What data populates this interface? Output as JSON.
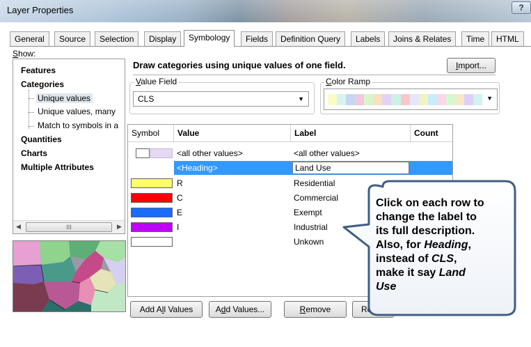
{
  "window": {
    "title": "Layer Properties",
    "help_glyph": "?"
  },
  "tabs": [
    {
      "label": "General"
    },
    {
      "label": "Source"
    },
    {
      "label": "Selection"
    },
    {
      "label": "Display"
    },
    {
      "label": "Symbology"
    },
    {
      "label": "Fields"
    },
    {
      "label": "Definition Query"
    },
    {
      "label": "Labels"
    },
    {
      "label": "Joins & Relates"
    },
    {
      "label": "Time"
    },
    {
      "label": "HTML"
    }
  ],
  "active_tab": "Symbology",
  "show": {
    "label": "Show:",
    "items": [
      {
        "label": "Features"
      },
      {
        "label": "Categories"
      },
      {
        "label": "Unique values"
      },
      {
        "label": "Unique values, many"
      },
      {
        "label": "Match to symbols in a"
      },
      {
        "label": "Quantities"
      },
      {
        "label": "Charts"
      },
      {
        "label": "Multiple Attributes"
      }
    ],
    "scroll_thumb_glyph": "III"
  },
  "description": "Draw categories using unique values of one field.",
  "import_button": "Import...",
  "value_field": {
    "legend": "Value Field",
    "value": "CLS"
  },
  "color_ramp": {
    "legend": "Color Ramp",
    "colors": [
      "#fbfbc8",
      "#d8f2f2",
      "#c6d6f6",
      "#f2c8dc",
      "#d8f5cc",
      "#f8e0c0",
      "#e4d2f4",
      "#ccf2e4",
      "#f8c8c8",
      "#e6e6fa",
      "#f2f2c2",
      "#c8ecfa",
      "#fcd6e6",
      "#d6f8d0",
      "#f6e8c8",
      "#ddd0f6",
      "#d0f4f0"
    ]
  },
  "table": {
    "headers": {
      "symbol": "Symbol",
      "value": "Value",
      "label": "Label",
      "count": "Count"
    },
    "rows": [
      {
        "value": "<all other values>",
        "label": "<all other values>",
        "count": "",
        "color": "#e6d8f4",
        "swatch_color": "#ffffff"
      },
      {
        "value": "<Heading>",
        "label": "Land Use",
        "count": "",
        "heading": true
      },
      {
        "value": "R",
        "label": "Residential",
        "count": "?",
        "color": "#ffff66"
      },
      {
        "value": "C",
        "label": "Commercial",
        "count": "",
        "color": "#ff0000"
      },
      {
        "value": "E",
        "label": "Exempt",
        "count": "",
        "color": "#1a6bff"
      },
      {
        "value": "I",
        "label": "Industrial",
        "count": "",
        "color": "#c000ff"
      },
      {
        "value": "",
        "label": "Unkown",
        "count": "",
        "color": "#ffffff"
      }
    ]
  },
  "callout": {
    "lines": [
      {
        "text": "Click on each row to"
      },
      {
        "text": "change the label to"
      },
      {
        "text": "its full description."
      },
      {
        "text": "Also, for "
      },
      {
        "text": "Heading"
      },
      {
        "text": ","
      },
      {
        "text": "instead of "
      },
      {
        "text": "CLS"
      },
      {
        "text": ","
      },
      {
        "text": "make it say "
      },
      {
        "text": "Land"
      },
      {
        "text": "Use"
      }
    ]
  },
  "buttons": {
    "add_all_values": "Add All Values",
    "add_values": "Add Values...",
    "remove": "Remove",
    "reverse_partial": "Re"
  }
}
